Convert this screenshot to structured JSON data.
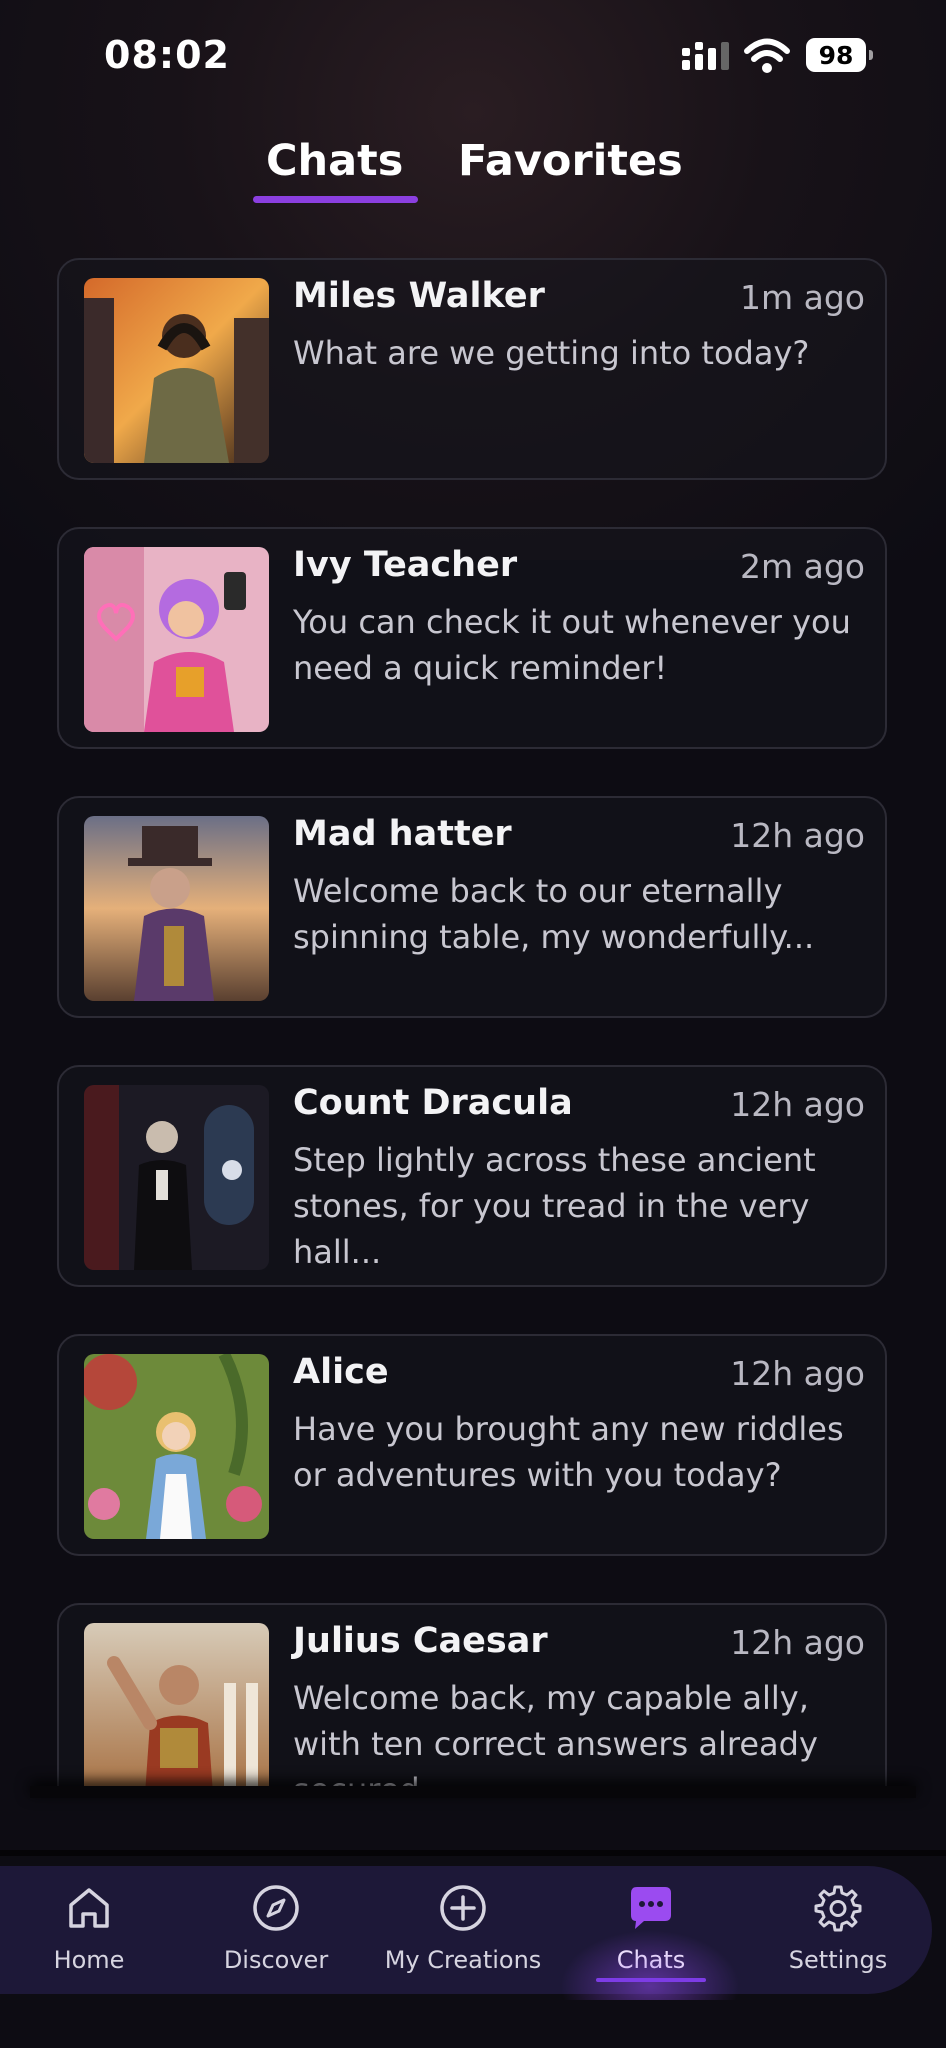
{
  "status_bar": {
    "time": "08:02",
    "battery": "98"
  },
  "tabs": {
    "chats": "Chats",
    "favorites": "Favorites",
    "active": "Chats"
  },
  "chats": [
    {
      "name": "Miles Walker",
      "ago": "1m ago",
      "message": "What are we getting into today?"
    },
    {
      "name": "Ivy Teacher",
      "ago": "2m ago",
      "message": "You can check it out whenever you need a quick reminder!"
    },
    {
      "name": "Mad hatter",
      "ago": "12h ago",
      "message": "Welcome back to our eternally spinning table, my wonderfully..."
    },
    {
      "name": "Count Dracula",
      "ago": "12h ago",
      "message": "Step lightly across these ancient stones, for you tread in the very hall..."
    },
    {
      "name": "Alice",
      "ago": "12h ago",
      "message": "Have you brought any new riddles or adventures with you today?"
    },
    {
      "name": "Julius Caesar",
      "ago": "12h ago",
      "message": "Welcome back, my capable ally, with ten correct answers already secured..."
    }
  ],
  "nav": {
    "home": {
      "label": "Home",
      "icon": "home-icon"
    },
    "discover": {
      "label": "Discover",
      "icon": "compass-icon"
    },
    "creations": {
      "label": "My Creations",
      "icon": "plus-circle-icon"
    },
    "chats": {
      "label": "Chats",
      "icon": "chat-bubble-icon"
    },
    "settings": {
      "label": "Settings",
      "icon": "gear-icon"
    },
    "active": "Chats"
  },
  "colors": {
    "accent": "#8b3fe0",
    "nav_bg": "#1d1838",
    "card_border": "#2c2b35",
    "background": "#0d0c13"
  }
}
